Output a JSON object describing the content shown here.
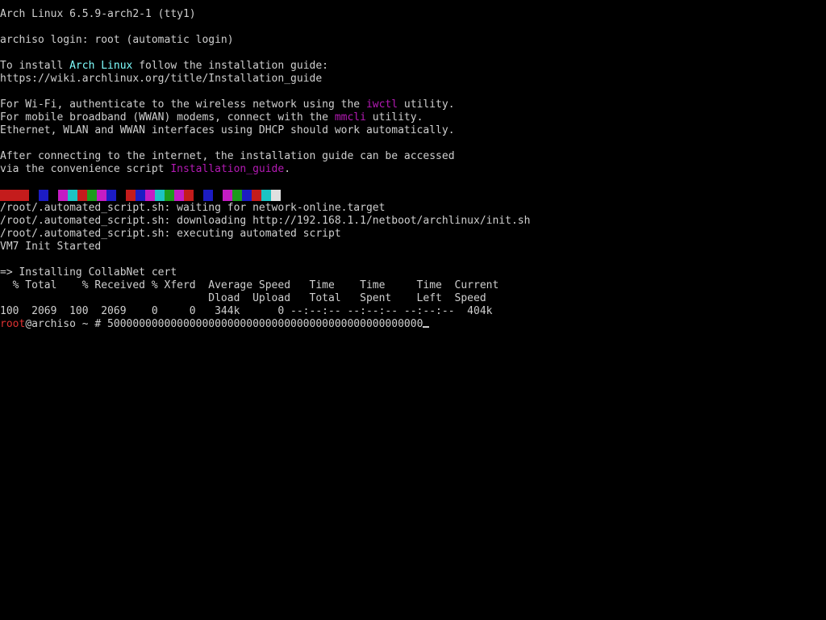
{
  "terminal": {
    "default_color": "#cfcfcf",
    "colors": {
      "cyan": "#7fffff",
      "magenta": "#b41ab4",
      "red": "#e03232",
      "cursor": "#cfcfcf"
    },
    "lines": [
      {
        "segments": [
          {
            "text": "Arch Linux 6.5.9-arch2-1 (tty1)"
          }
        ]
      },
      {
        "segments": [
          {
            "text": ""
          }
        ]
      },
      {
        "segments": [
          {
            "text": "archiso login: root (automatic login)"
          }
        ]
      },
      {
        "segments": [
          {
            "text": ""
          }
        ]
      },
      {
        "segments": [
          {
            "text": "To install "
          },
          {
            "text": "Arch Linux",
            "color": "#7fffff"
          },
          {
            "text": " follow the installation guide:"
          }
        ]
      },
      {
        "segments": [
          {
            "text": "https://wiki.archlinux.org/title/Installation_guide"
          }
        ]
      },
      {
        "segments": [
          {
            "text": ""
          }
        ]
      },
      {
        "segments": [
          {
            "text": "For Wi-Fi, authenticate to the wireless network using the "
          },
          {
            "text": "iwctl",
            "color": "#b41ab4"
          },
          {
            "text": " utility."
          }
        ]
      },
      {
        "segments": [
          {
            "text": "For mobile broadband (WWAN) modems, connect with the "
          },
          {
            "text": "mmcli",
            "color": "#b41ab4"
          },
          {
            "text": " utility."
          }
        ]
      },
      {
        "segments": [
          {
            "text": "Ethernet, WLAN and WWAN interfaces using DHCP should work automatically."
          }
        ]
      },
      {
        "segments": [
          {
            "text": ""
          }
        ]
      },
      {
        "segments": [
          {
            "text": "After connecting to the internet, the installation guide can be accessed"
          }
        ]
      },
      {
        "segments": [
          {
            "text": "via the convenience script "
          },
          {
            "text": "Installation_guide",
            "color": "#b41ab4"
          },
          {
            "text": "."
          }
        ]
      },
      {
        "segments": [
          {
            "text": ""
          }
        ]
      },
      {
        "stripe": true
      },
      {
        "segments": [
          {
            "text": "/root/.automated_script.sh: waiting for network-online.target"
          }
        ]
      },
      {
        "segments": [
          {
            "text": "/root/.automated_script.sh: downloading http://192.168.1.1/netboot/archlinux/init.sh"
          }
        ]
      },
      {
        "segments": [
          {
            "text": "/root/.automated_script.sh: executing automated script"
          }
        ]
      },
      {
        "segments": [
          {
            "text": "VM7 Init Started"
          }
        ]
      },
      {
        "segments": [
          {
            "text": ""
          }
        ]
      },
      {
        "segments": [
          {
            "text": "=> Installing CollabNet cert"
          }
        ]
      },
      {
        "segments": [
          {
            "text": "  % Total    % Received % Xferd  Average Speed   Time    Time     Time  Current"
          }
        ]
      },
      {
        "segments": [
          {
            "text": "                                 Dload  Upload   Total   Spent    Left  Speed"
          }
        ]
      },
      {
        "segments": [
          {
            "text": "100  2069  100  2069    0     0   344k      0 --:--:-- --:--:-- --:--:--  404k"
          }
        ]
      },
      {
        "prompt": true,
        "segments": [
          {
            "text": "root",
            "color": "#e03232"
          },
          {
            "text": "@archiso ~ # 50000000000000000000000000000000000000000000000000"
          }
        ]
      }
    ],
    "stripe_blocks": [
      {
        "color": "#c41c1c",
        "units": 3
      },
      {
        "color": "#000000",
        "units": 1
      },
      {
        "color": "#1c1cc4",
        "units": 1
      },
      {
        "color": "#000000",
        "units": 1
      },
      {
        "color": "#c41cc4",
        "units": 1
      },
      {
        "color": "#1cc4c4",
        "units": 1
      },
      {
        "color": "#c41c1c",
        "units": 1
      },
      {
        "color": "#1c9c1c",
        "units": 1
      },
      {
        "color": "#c41cc4",
        "units": 1
      },
      {
        "color": "#1c1cc4",
        "units": 1
      },
      {
        "color": "#000000",
        "units": 1
      },
      {
        "color": "#c41c1c",
        "units": 1
      },
      {
        "color": "#1c1cc4",
        "units": 1
      },
      {
        "color": "#c41cc4",
        "units": 1
      },
      {
        "color": "#1cc4c4",
        "units": 1
      },
      {
        "color": "#1c9c1c",
        "units": 1
      },
      {
        "color": "#c41cc4",
        "units": 1
      },
      {
        "color": "#c41c1c",
        "units": 1
      },
      {
        "color": "#000000",
        "units": 1
      },
      {
        "color": "#1c1cc4",
        "units": 1
      },
      {
        "color": "#000000",
        "units": 1
      },
      {
        "color": "#c41cc4",
        "units": 1
      },
      {
        "color": "#1c9c1c",
        "units": 1
      },
      {
        "color": "#1c1cc4",
        "units": 1
      },
      {
        "color": "#c41c1c",
        "units": 1
      },
      {
        "color": "#1cc4c4",
        "units": 1
      },
      {
        "color": "#e0e0e0",
        "units": 1
      }
    ],
    "cursor_visible": true
  }
}
